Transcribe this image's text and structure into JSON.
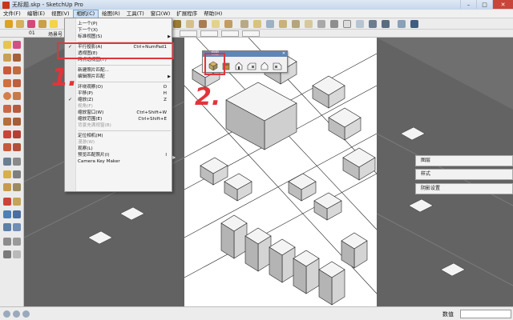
{
  "window": {
    "title": "无标题.skp - SketchUp Pro",
    "minimize": "–",
    "maximize": "□",
    "close": "✕"
  },
  "menubar": {
    "items": [
      "文件(F)",
      "编辑(E)",
      "视图(V)",
      "相机(C)",
      "绘图(R)",
      "工具(T)",
      "窗口(W)",
      "扩展程序",
      "帮助(H)"
    ],
    "active": "相机(C)"
  },
  "scenes": {
    "number": "01",
    "label": "场景号"
  },
  "camera_menu": {
    "items": [
      {
        "label": "上一个(P)",
        "shortcut": "",
        "checked": false,
        "disabled": false,
        "submenu": false
      },
      {
        "label": "下一个(X)",
        "shortcut": "",
        "checked": false,
        "disabled": false,
        "submenu": false
      },
      {
        "label": "标准视图(S)",
        "shortcut": "",
        "checked": false,
        "disabled": false,
        "submenu": true
      },
      {
        "label": "平行投影(A)",
        "shortcut": "Ctrl+NumPad1",
        "checked": true,
        "disabled": false,
        "submenu": false
      },
      {
        "label": "透视图(E)",
        "shortcut": "",
        "checked": false,
        "disabled": false,
        "submenu": false
      },
      {
        "label": "两点透视图(T)",
        "shortcut": "",
        "checked": false,
        "disabled": false,
        "submenu": false
      },
      {
        "label": "新建照片匹配...",
        "shortcut": "",
        "checked": false,
        "disabled": false,
        "submenu": false
      },
      {
        "label": "编辑照片匹配",
        "shortcut": "",
        "checked": false,
        "disabled": false,
        "submenu": true
      },
      {
        "label": "环绕观察(O)",
        "shortcut": "O",
        "checked": false,
        "disabled": false,
        "submenu": false
      },
      {
        "label": "平移(P)",
        "shortcut": "H",
        "checked": false,
        "disabled": false,
        "submenu": false
      },
      {
        "label": "缩放(Z)",
        "shortcut": "Z",
        "checked": true,
        "disabled": false,
        "submenu": false
      },
      {
        "label": "视角(F)",
        "shortcut": "",
        "checked": false,
        "disabled": true,
        "submenu": false
      },
      {
        "label": "缩放窗口(W)",
        "shortcut": "Ctrl+Shift+W",
        "checked": false,
        "disabled": false,
        "submenu": false
      },
      {
        "label": "缩放范围(E)",
        "shortcut": "Ctrl+Shift+E",
        "checked": false,
        "disabled": false,
        "submenu": false
      },
      {
        "label": "背景充满视窗(B)",
        "shortcut": "",
        "checked": false,
        "disabled": true,
        "submenu": false
      },
      {
        "label": "定位相机(M)",
        "shortcut": "",
        "checked": false,
        "disabled": false,
        "submenu": false
      },
      {
        "label": "漫游(W)",
        "shortcut": "",
        "checked": false,
        "disabled": true,
        "submenu": false
      },
      {
        "label": "观察(L)",
        "shortcut": "",
        "checked": false,
        "disabled": false,
        "submenu": false
      },
      {
        "label": "预览匹配照片(I)",
        "shortcut": "I",
        "checked": false,
        "disabled": false,
        "submenu": false
      },
      {
        "label": "Camera Key Maker",
        "shortcut": "",
        "checked": false,
        "disabled": false,
        "submenu": false
      }
    ]
  },
  "views_toolbar": {
    "title": "视图",
    "close": "✕",
    "icons": [
      "iso-view-icon",
      "top-view-icon",
      "front-view-icon",
      "right-view-icon",
      "back-view-icon",
      "left-view-icon"
    ]
  },
  "annotations": {
    "step1": "1.",
    "step2": "2."
  },
  "trays": {
    "panels": [
      "图层",
      "样式",
      "阴影设置"
    ]
  },
  "status": {
    "measure_label": "数值"
  }
}
